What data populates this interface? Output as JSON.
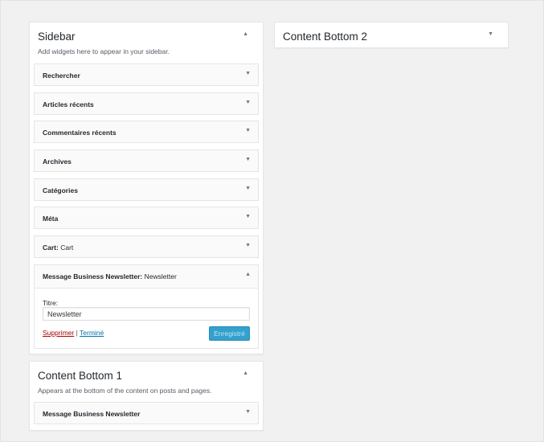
{
  "sidebar": {
    "title": "Sidebar",
    "description": "Add widgets here to appear in your sidebar.",
    "arrow": "▲",
    "widgets": [
      {
        "title": "Rechercher",
        "instance": ""
      },
      {
        "title": "Articles récents",
        "instance": ""
      },
      {
        "title": "Commentaires récents",
        "instance": ""
      },
      {
        "title": "Archives",
        "instance": ""
      },
      {
        "title": "Catégories",
        "instance": ""
      },
      {
        "title": "Méta",
        "instance": ""
      },
      {
        "title": "Cart",
        "instance": "Cart"
      }
    ],
    "open_widget": {
      "title": "Message Business Newsletter",
      "instance": "Newsletter",
      "field_label": "Titre:",
      "field_value": "Newsletter",
      "delete_label": "Supprimer",
      "separator": "|",
      "done_label": "Terminé",
      "save_label": "Enregistré"
    }
  },
  "content_bottom_1": {
    "title": "Content Bottom 1",
    "description": "Appears at the bottom of the content on posts and pages.",
    "arrow": "▲",
    "widgets": [
      {
        "title": "Message Business Newsletter",
        "instance": ""
      }
    ]
  },
  "content_bottom_2": {
    "title": "Content Bottom 2",
    "arrow": "▼"
  },
  "widget_arrow": "▼",
  "widget_separator": ":",
  "icons": {
    "collapse": "triangle-up-icon",
    "expand": "triangle-down-icon"
  },
  "colors": {
    "background": "#f1f1f1",
    "panel": "#ffffff",
    "widget": "#fafafa",
    "border": "#e5e5e5",
    "primary_button": "#33a0ce",
    "delete_link": "#aa0000",
    "done_link": "#0073aa"
  }
}
